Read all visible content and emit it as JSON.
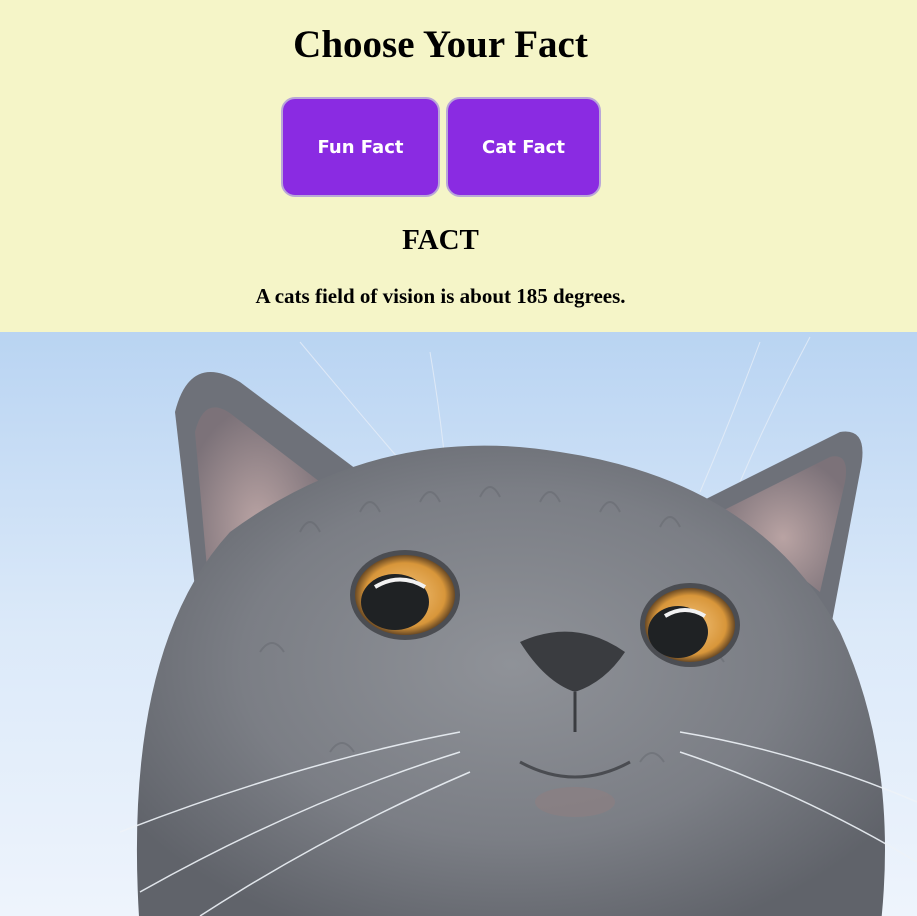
{
  "header": {
    "title": "Choose Your Fact"
  },
  "buttons": {
    "fun_fact_label": "Fun Fact",
    "cat_fact_label": "Cat Fact"
  },
  "fact": {
    "heading": "FACT",
    "text": "A cats field of vision is about 185 degrees."
  },
  "image": {
    "subject": "gray-cat-photo"
  },
  "colors": {
    "background": "#f5f5c8",
    "button": "#8a2be2",
    "button_text": "#ffffff"
  }
}
